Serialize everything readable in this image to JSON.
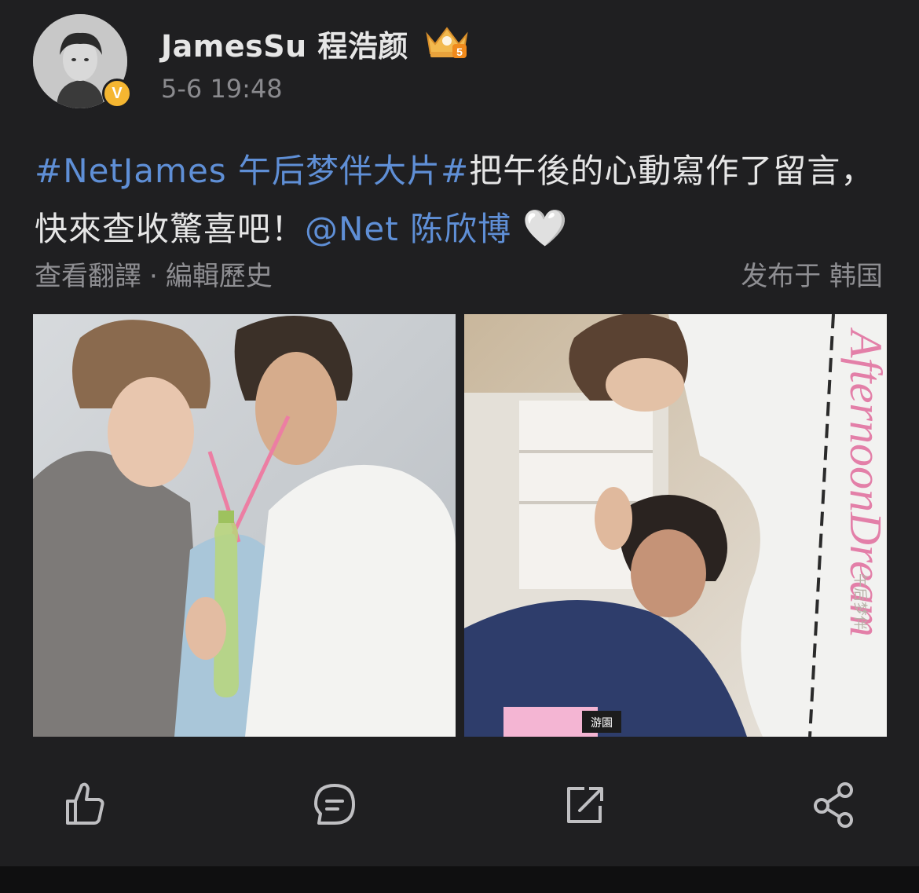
{
  "post": {
    "author": {
      "name": "JamesSu 程浩颜",
      "verified_badge": "V",
      "crown_icon": "crown-icon",
      "crown_level": "5"
    },
    "timestamp": "5-6 19:48",
    "content": {
      "topic": "#NetJames 午后梦伴大片#",
      "text": "把午後的心動寫作了留言，快來查收驚喜吧！",
      "mention": "@Net 陈欣博",
      "emoji": "🤍"
    },
    "meta": {
      "translate_label": "查看翻譯",
      "separator": "·",
      "edit_history_label": "編輯歷史",
      "location_label": "发布于 韩国"
    },
    "photos": [
      {
        "name": "photo-1"
      },
      {
        "name": "photo-2",
        "overlay_text": "AfternoonDream",
        "overlay_sub": "午后梦伴",
        "badge_text": "游園"
      }
    ],
    "actions": [
      {
        "name": "like-button",
        "icon": "thumbs-up-icon"
      },
      {
        "name": "comment-button",
        "icon": "comment-icon"
      },
      {
        "name": "repost-button",
        "icon": "repost-icon"
      },
      {
        "name": "share-button",
        "icon": "share-icon"
      }
    ]
  },
  "colors": {
    "background": "#1f1f21",
    "link": "#5f8fd6",
    "secondary_text": "#8e8e92",
    "verified": "#f5b631"
  }
}
